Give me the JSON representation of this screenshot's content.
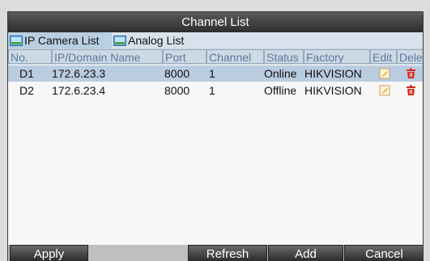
{
  "window": {
    "title": "Channel List"
  },
  "tabs": [
    {
      "label": "IP Camera List",
      "icon": "ip-camera-icon"
    },
    {
      "label": "Analog List",
      "icon": "analog-camera-icon"
    }
  ],
  "table": {
    "headers": [
      "No.",
      "IP/Domain Name",
      "Port",
      "Channel",
      "Status",
      "Factory",
      "Edit",
      "Dele"
    ],
    "rows": [
      {
        "no": "D1",
        "ip": "172.6.23.3",
        "port": "8000",
        "channel": "1",
        "status": "Online",
        "factory": "HIKVISION"
      },
      {
        "no": "D2",
        "ip": "172.6.23.4",
        "port": "8000",
        "channel": "1",
        "status": "Offline",
        "factory": "HIKVISION"
      }
    ]
  },
  "buttons": {
    "apply": "Apply",
    "refresh": "Refresh",
    "add": "Add",
    "cancel": "Cancel"
  },
  "colors": {
    "title_bg": "#2d2d2d",
    "selected_row": "#b9cce0",
    "header_text": "#5a7aa0",
    "delete_icon": "#d62a1e",
    "edit_icon": "#e8a030"
  }
}
